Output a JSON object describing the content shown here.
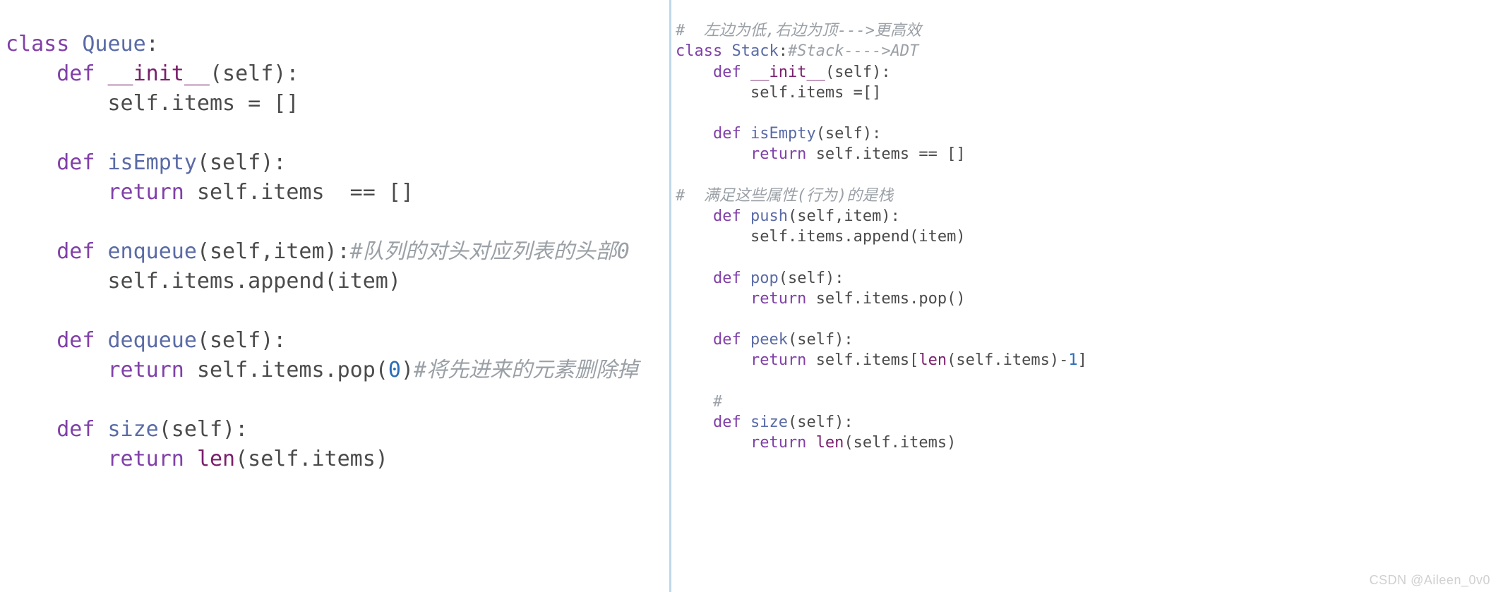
{
  "left": {
    "l1a": "class ",
    "l1b": "Queue",
    "l1c": ":",
    "l2a": "    def ",
    "l2b": "__init__",
    "l2c": "(self):",
    "l3": "        self.items = []",
    "l4": "",
    "l5a": "    def ",
    "l5b": "isEmpty",
    "l5c": "(self):",
    "l6a": "        return ",
    "l6b": "self.items  == []",
    "l7": "",
    "l8a": "    def ",
    "l8b": "enqueue",
    "l8c": "(self,item):",
    "l8d": "#队列的对头对应列表的头部0",
    "l9": "        self.items.append(item)",
    "l10": "",
    "l11a": "    def ",
    "l11b": "dequeue",
    "l11c": "(self):",
    "l12a": "        return ",
    "l12b": "self.items.pop(",
    "l12c": "0",
    "l12d": ")",
    "l12e": "#将先进来的元素删除掉",
    "l13": "",
    "l14a": "    def ",
    "l14b": "size",
    "l14c": "(self):",
    "l15a": "        return ",
    "l15b": "len",
    "l15c": "(self.items)"
  },
  "right": {
    "r1": "#  左边为低,右边为顶--->更高效",
    "r2a": "class ",
    "r2b": "Stack",
    "r2c": ":",
    "r2d": "#Stack---->ADT",
    "r3a": "    def ",
    "r3b": "__init__",
    "r3c": "(self):",
    "r4": "        self.items =[]",
    "r5": "",
    "r6a": "    def ",
    "r6b": "isEmpty",
    "r6c": "(self):",
    "r7a": "        return ",
    "r7b": "self.items == []",
    "r8": "",
    "r9": "#  满足这些属性(行为)的是栈",
    "r10a": "    def ",
    "r10b": "push",
    "r10c": "(self,item):",
    "r11": "        self.items.append(item)",
    "r12": "",
    "r13a": "    def ",
    "r13b": "pop",
    "r13c": "(self):",
    "r14a": "        return ",
    "r14b": "self.items.pop()",
    "r15": "",
    "r16a": "    def ",
    "r16b": "peek",
    "r16c": "(self):",
    "r17a": "        return ",
    "r17b": "self.items[",
    "r17c": "len",
    "r17d": "(self.items)-",
    "r17e": "1",
    "r17f": "]",
    "r18": "",
    "r19": "    #",
    "r20a": "    def ",
    "r20b": "size",
    "r20c": "(self):",
    "r21a": "        return ",
    "r21b": "len",
    "r21c": "(self.items)"
  },
  "watermark": "CSDN @Aileen_0v0"
}
